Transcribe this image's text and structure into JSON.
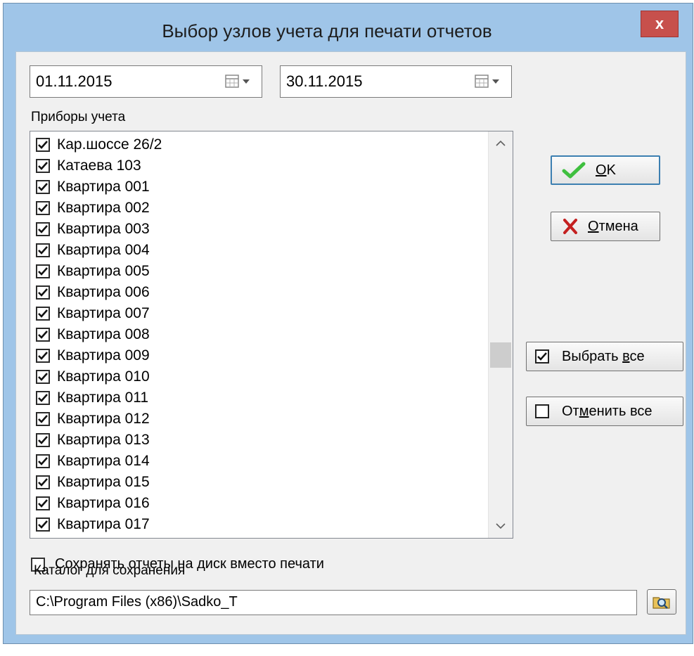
{
  "window": {
    "title": "Выбор узлов учета для печати отчетов",
    "close_label": "x"
  },
  "date_from": {
    "value": "01.11.2015"
  },
  "date_to": {
    "value": "30.11.2015"
  },
  "devices_label": "Приборы учета",
  "devices": [
    {
      "label": "Кар.шоссе 26/2",
      "checked": true
    },
    {
      "label": "Катаева 103",
      "checked": true
    },
    {
      "label": "Квартира 001",
      "checked": true
    },
    {
      "label": "Квартира 002",
      "checked": true
    },
    {
      "label": "Квартира 003",
      "checked": true
    },
    {
      "label": "Квартира 004",
      "checked": true
    },
    {
      "label": "Квартира 005",
      "checked": true
    },
    {
      "label": "Квартира 006",
      "checked": true
    },
    {
      "label": "Квартира 007",
      "checked": true
    },
    {
      "label": "Квартира 008",
      "checked": true
    },
    {
      "label": "Квартира 009",
      "checked": true
    },
    {
      "label": "Квартира 010",
      "checked": true
    },
    {
      "label": "Квартира 011",
      "checked": true
    },
    {
      "label": "Квартира 012",
      "checked": true
    },
    {
      "label": "Квартира 013",
      "checked": true
    },
    {
      "label": "Квартира 014",
      "checked": true
    },
    {
      "label": "Квартира 015",
      "checked": true
    },
    {
      "label": "Квартира 016",
      "checked": true
    },
    {
      "label": "Квартира 017",
      "checked": true
    }
  ],
  "buttons": {
    "ok": {
      "accel": "O",
      "rest": "K"
    },
    "cancel": {
      "accel": "О",
      "rest": "тмена"
    },
    "select_all": {
      "before": "Выбрать ",
      "accel": "в",
      "after": "се"
    },
    "deselect_all": {
      "before": "От",
      "accel": "м",
      "after": "енить все"
    }
  },
  "save_to_disk": {
    "label": "Сохранять отчеты на диск вместо печати",
    "checked": false
  },
  "save_folder_label": "Каталог для сохранения",
  "save_folder_path": "C:\\Program Files (x86)\\Sadko_T",
  "colors": {
    "title_bar": "#9fc5e8",
    "close_button": "#c7504c",
    "ok_check": "#3fbf3f",
    "cancel_x": "#c42020"
  }
}
